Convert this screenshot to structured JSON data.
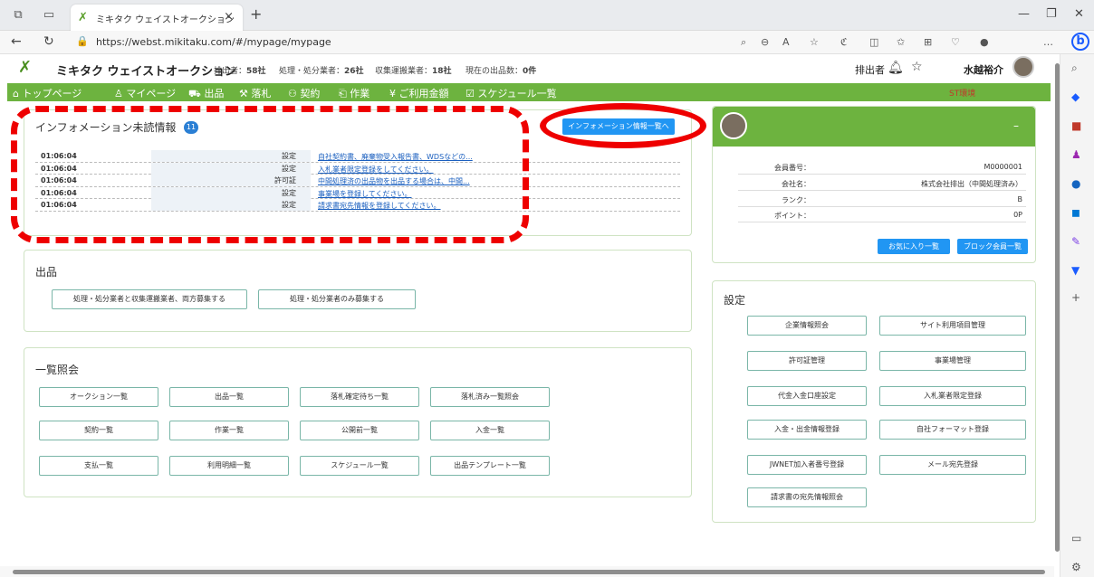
{
  "browser": {
    "tab_title": "ミキタク ウェイストオークション",
    "url": "https://webst.mikitaku.com/#/mypage/mypage"
  },
  "header": {
    "app_name": "ミキタク ウェイストオークション",
    "stats": [
      {
        "label": "排出者：",
        "value": "58社"
      },
      {
        "label": "処理・処分業者：",
        "value": "26社"
      },
      {
        "label": "収集運搬業者：",
        "value": "18社"
      },
      {
        "label": "現在の出品数：",
        "value": "0件"
      }
    ],
    "role": "排出者",
    "user_name": "水越裕介"
  },
  "nav": {
    "items": [
      "トップページ",
      "マイページ",
      "出品",
      "落札",
      "契約",
      "作業",
      "ご利用金額",
      "スケジュール一覧"
    ],
    "env_label": "ST環境"
  },
  "info": {
    "title": "インフォメーション未読情報",
    "badge": "11",
    "list_button": "インフォメーション情報一覧へ",
    "rows": [
      {
        "time": "01:06:04",
        "type": "設定",
        "message": "自社契約書、廃棄物受入報告書、WDSなどの..."
      },
      {
        "time": "01:06:04",
        "type": "設定",
        "message": "入札業者限定登録をしてください。"
      },
      {
        "time": "01:06:04",
        "type": "許可証",
        "message": "中間処理済の出品物を出品する場合は、中間..."
      },
      {
        "time": "01:06:04",
        "type": "設定",
        "message": "事業場を登録してください。"
      },
      {
        "time": "01:06:04",
        "type": "設定",
        "message": "請求書宛先情報を登録してください。"
      }
    ]
  },
  "profile": {
    "collapse_icon": "minus",
    "rows": [
      {
        "key": "会員番号：",
        "value": "M0000001"
      },
      {
        "key": "会社名：",
        "value": "株式会社排出（中間処理済み）"
      },
      {
        "key": "ランク：",
        "value": "B"
      },
      {
        "key": "ポイント：",
        "value": "0P"
      }
    ],
    "favorites_button": "お気に入り一覧",
    "block_button": "ブロック会員一覧"
  },
  "shuppin": {
    "title": "出品",
    "buttons": [
      "処理・処分業者と収集運搬業者、両方募集する",
      "処理・処分業者のみ募集する"
    ]
  },
  "list": {
    "title": "一覧照会",
    "buttons": [
      "オークション一覧",
      "出品一覧",
      "落札確定待ち一覧",
      "落札済み一覧照会",
      "契約一覧",
      "作業一覧",
      "公開前一覧",
      "入金一覧",
      "支払一覧",
      "利用明細一覧",
      "スケジュール一覧",
      "出品テンプレート一覧"
    ]
  },
  "settings": {
    "title": "設定",
    "buttons": [
      "企業情報照会",
      "サイト利用項目管理",
      "許可証管理",
      "事業場管理",
      "代金入金口座設定",
      "入札業者限定登録",
      "入金・出金情報登録",
      "自社フォーマット登録",
      "JWNET加入者番号登録",
      "メール宛先登録",
      "請求書の宛先情報照会"
    ]
  },
  "colors": {
    "accent_green": "#6db33f",
    "button_blue": "#2196f3",
    "annotation_red": "#e00000"
  }
}
